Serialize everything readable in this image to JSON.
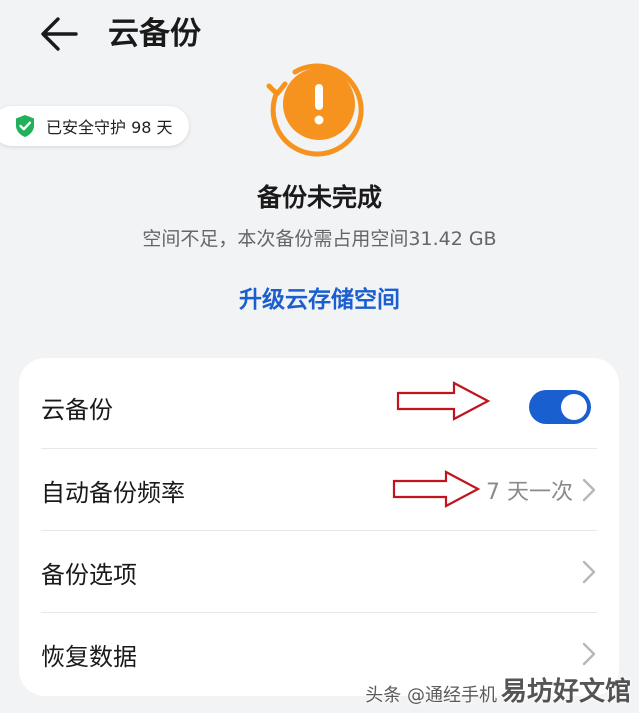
{
  "header": {
    "title": "云备份"
  },
  "protection_badge": {
    "text": "已安全守护 98 天"
  },
  "status": {
    "title": "备份未完成",
    "description": "空间不足，本次备份需占用空间31.42 GB",
    "upgrade_link": "升级云存储空间"
  },
  "settings": {
    "cloud_backup": {
      "label": "云备份",
      "enabled": true
    },
    "auto_frequency": {
      "label": "自动备份频率",
      "value": "7 天一次"
    },
    "backup_options": {
      "label": "备份选项"
    },
    "restore_data": {
      "label": "恢复数据"
    }
  },
  "watermark": {
    "small": "头条 @通经手机",
    "big": "易坊好文馆"
  },
  "colors": {
    "accent": "#1a5fd0",
    "warning": "#f5931e",
    "shield": "#21b15a",
    "annotation_arrow": "#c0141e"
  },
  "icons": {
    "back": "arrow-left-icon",
    "shield": "shield-check-icon",
    "status": "warning-exclamation-icon",
    "chevron": "chevron-right-icon"
  }
}
